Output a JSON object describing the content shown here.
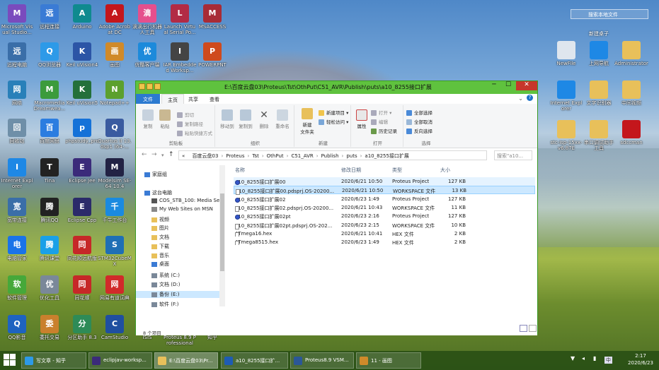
{
  "desktop_icons_left": [
    {
      "label": "Microsoft Visual Studio...",
      "icon": "visual-studio-icon",
      "color": "#7a4bbd"
    },
    {
      "label": "远程连接",
      "icon": "computer-icon",
      "color": "#3a7bd5"
    },
    {
      "label": "Arduino",
      "icon": "arduino-icon",
      "color": "#0f8a8f"
    },
    {
      "label": "Adobe Acrobat DC",
      "icon": "acrobat-icon",
      "color": "#c4161c"
    },
    {
      "label": "滴滴出行机器人工具",
      "icon": "app-icon",
      "color": "#e54f8d"
    },
    {
      "label": "Launch Virtual Serial Po...",
      "icon": "serial-icon",
      "color": "#b22b45"
    },
    {
      "label": "MSACCESS",
      "icon": "access-icon",
      "color": "#a82b36"
    },
    {
      "label": "远程电脑",
      "icon": "computer-icon",
      "color": "#3a6ea8"
    },
    {
      "label": "QQ浏览器",
      "icon": "qq-browser-icon",
      "color": "#2d9ae8"
    },
    {
      "label": "Keil uVision4",
      "icon": "keil-icon",
      "color": "#2c55a6"
    },
    {
      "label": "画图",
      "icon": "paint-icon",
      "color": "#d08a2a"
    },
    {
      "label": "优酷客户端",
      "icon": "youku-icon",
      "color": "#1c8adb"
    },
    {
      "label": "IAR Embedded Worksp...",
      "icon": "iar-icon",
      "color": "#444444"
    },
    {
      "label": "POWERPNT",
      "icon": "powerpoint-icon",
      "color": "#cf4a1d"
    },
    {
      "label": "网络",
      "icon": "network-icon",
      "color": "#2980b9"
    },
    {
      "label": "Macromedia Dreamwea...",
      "icon": "dreamweaver-icon",
      "color": "#3c9b3c"
    },
    {
      "label": "Keil uVision5",
      "icon": "keil-icon",
      "color": "#24703a"
    },
    {
      "label": "Notepad++",
      "icon": "notepad-icon",
      "color": "#5ca02e"
    },
    {
      "label": "回收站",
      "icon": "recycle-bin-icon",
      "color": "#6f8fa8"
    },
    {
      "label": "百度网盘",
      "icon": "baidu-pan-icon",
      "color": "#2b7de0"
    },
    {
      "label": "phpstudy_pro",
      "icon": "phpstudy-icon",
      "color": "#1572d8"
    },
    {
      "label": "Quartus II 13.0sp1 (64-...",
      "icon": "quartus-icon",
      "color": "#3a5ba0"
    },
    {
      "label": "Internet Explorer",
      "icon": "ie-icon",
      "color": "#1e88e5"
    },
    {
      "label": "Tina",
      "icon": "tina-icon",
      "color": "#222222"
    },
    {
      "label": "Eclipse Jee",
      "icon": "eclipse-icon",
      "color": "#3b2b7a"
    },
    {
      "label": "Modelsim SE-64 10.4",
      "icon": "modelsim-icon",
      "color": "#222244"
    },
    {
      "label": "宽带连接",
      "icon": "broadband-icon",
      "color": "#3a6ea8"
    },
    {
      "label": "腾讯QQ",
      "icon": "qq-icon",
      "color": "#222222"
    },
    {
      "label": "Eclipse Cpp",
      "icon": "eclipse-icon",
      "color": "#2b2b6a"
    },
    {
      "label": "千牛工作台",
      "icon": "qianniu-icon",
      "color": "#1a8ae0"
    },
    {
      "label": "电脑管家",
      "icon": "pc-manager-icon",
      "color": "#1a73e8"
    },
    {
      "label": "腾讯课堂",
      "icon": "tencent-class-icon",
      "color": "#1aa0e8"
    },
    {
      "label": "同花顺远航版",
      "icon": "tonghuashun-icon",
      "color": "#c62828"
    },
    {
      "label": "STM32CubeMX",
      "icon": "stm32cubemx-icon",
      "color": "#1f6fb5"
    },
    {
      "label": "软件管理",
      "icon": "software-icon",
      "color": "#46a83a"
    },
    {
      "label": "优化工具",
      "icon": "tool-icon",
      "color": "#7a8899"
    },
    {
      "label": "同花顺",
      "icon": "tonghuashun-icon",
      "color": "#c62828"
    },
    {
      "label": "网易有道词典",
      "icon": "youdao-icon",
      "color": "#d12a2a"
    },
    {
      "label": "QQ影音",
      "icon": "qq-player-icon",
      "color": "#1e63c0"
    },
    {
      "label": "委托交易",
      "icon": "trade-icon",
      "color": "#c9802d"
    },
    {
      "label": "分区助手 8.3",
      "icon": "partition-icon",
      "color": "#2e8b57"
    },
    {
      "label": "CamStudio",
      "icon": "camstudio-icon",
      "color": "#1f4fa0"
    },
    {
      "label": "ISIS",
      "icon": "isis-icon",
      "color": "#2d4e8a"
    },
    {
      "label": "Proteus 8.9 Professional",
      "icon": "proteus-icon",
      "color": "#1e5cb3"
    },
    {
      "label": "知乎",
      "icon": "zhihu-icon",
      "color": "#1772f6"
    }
  ],
  "desktop_icons_right": [
    {
      "label": "NewFile",
      "icon": "file-icon",
      "color": "#dfe6ee"
    },
    {
      "label": "上网导航",
      "icon": "ie-icon",
      "color": "#1e88e5"
    },
    {
      "label": "Administrator",
      "icon": "folder-icon",
      "color": "#e8c05a"
    },
    {
      "label": "Internet Explorer",
      "icon": "ie-icon",
      "color": "#1e88e5"
    },
    {
      "label": "文字识别器",
      "icon": "folder-icon",
      "color": "#e8c05a"
    },
    {
      "label": "中间视频",
      "icon": "folder-icon",
      "color": "#e8c05a"
    },
    {
      "label": "stc-isp-15xx-v6.87E",
      "icon": "folder-icon",
      "color": "#e8c05a"
    },
    {
      "label": "串口调试助手工具",
      "icon": "folder-icon",
      "color": "#e8c05a"
    },
    {
      "label": "sdccman",
      "icon": "pdf-icon",
      "color": "#c4161c"
    }
  ],
  "desktop_search": "搜索本地文件",
  "desktop_new_folder": "新建桌子",
  "window": {
    "title": "E:\\百度云盘03\\Proteus\\Tst\\OthPut\\C51_AVR\\Publish\\puts\\a10_8255接口扩展",
    "minimize": "─",
    "maximize": "☐",
    "close": "✕",
    "tabs": [
      "文件",
      "主页",
      "共享",
      "查看"
    ],
    "ribbon": {
      "clipboard": {
        "name": "剪贴板",
        "copy": "复制",
        "paste": "粘贴",
        "cut": "剪切",
        "copy_path": "复制路径",
        "paste_shortcut": "粘贴快捷方式"
      },
      "organize": {
        "name": "组织",
        "move_to": "移动到",
        "copy_to": "复制到",
        "delete": "删除",
        "rename": "重命名"
      },
      "new": {
        "name": "新建",
        "new_folder": "新建\n文件夹",
        "new_item": "新建项目 ▾",
        "easy_access": "轻松访问 ▾"
      },
      "open": {
        "name": "打开",
        "properties": "属性",
        "open": "打开 ▾",
        "edit": "编辑",
        "history": "历史记录"
      },
      "select": {
        "name": "选择",
        "select_all": "全部选择",
        "select_none": "全部取消",
        "invert": "反向选择"
      }
    },
    "address": {
      "back": "←",
      "forward": "→",
      "up": "↑",
      "crumbs": [
        "«",
        "百度云盘03",
        "Proteus",
        "Tst",
        "OthPut",
        "C51_AVR",
        "Publish",
        "puts",
        "a10_8255接口扩展"
      ],
      "search_placeholder": "搜索\"a10..."
    },
    "nav_pane": [
      {
        "label": "家庭组",
        "icon": "homegroup-icon",
        "color": "#3a7bd5"
      },
      {
        "label": "这台电脑",
        "icon": "computer-icon",
        "color": "#3a7bd5"
      },
      {
        "label": "COS_STB_100: Media Serv",
        "icon": "media-server-icon",
        "color": "#555555"
      },
      {
        "label": "My Web Sites on MSN",
        "icon": "web-folder-icon",
        "color": "#888888"
      },
      {
        "label": "视频",
        "icon": "video-folder-icon",
        "color": "#e8c05a"
      },
      {
        "label": "图片",
        "icon": "picture-folder-icon",
        "color": "#e8c05a"
      },
      {
        "label": "文档",
        "icon": "document-folder-icon",
        "color": "#e8c05a"
      },
      {
        "label": "下载",
        "icon": "download-folder-icon",
        "color": "#e8c05a"
      },
      {
        "label": "音乐",
        "icon": "music-folder-icon",
        "color": "#e8c05a"
      },
      {
        "label": "桌面",
        "icon": "desktop-folder-icon",
        "color": "#3a7bd5"
      },
      {
        "label": "系统 (C:)",
        "icon": "drive-icon",
        "color": "#7a8899"
      },
      {
        "label": "文档 (D:)",
        "icon": "drive-icon",
        "color": "#7a8899"
      },
      {
        "label": "备份 (E:)",
        "icon": "drive-icon",
        "color": "#7a8899"
      },
      {
        "label": "软件 (F:)",
        "icon": "drive-icon",
        "color": "#7a8899"
      }
    ],
    "columns": [
      "名称",
      "修改日期",
      "类型",
      "大小"
    ],
    "files": [
      {
        "name": "a10_8255接口扩展00",
        "date": "2020/6/21 10:50",
        "type": "Proteus Project",
        "size": "127 KB",
        "icon": "proteus-project-icon"
      },
      {
        "name": "a10_8255接口扩展00.pdsprj.OS-20200...",
        "date": "2020/6/21 10:50",
        "type": "WORKSPACE 文件",
        "size": "13 KB",
        "icon": "file-icon"
      },
      {
        "name": "a10_8255接口扩展02",
        "date": "2020/6/23 1:49",
        "type": "Proteus Project",
        "size": "127 KB",
        "icon": "proteus-project-icon"
      },
      {
        "name": "a10_8255接口扩展02.pdsprj.OS-20200...",
        "date": "2020/6/21 10:43",
        "type": "WORKSPACE 文件",
        "size": "11 KB",
        "icon": "file-icon"
      },
      {
        "name": "a10_8255接口扩展02pt",
        "date": "2020/6/23 2:16",
        "type": "Proteus Project",
        "size": "127 KB",
        "icon": "proteus-project-icon"
      },
      {
        "name": "a10_8255接口扩展02pt.pdsprj.OS-202...",
        "date": "2020/6/23 2:15",
        "type": "WORKSPACE 文件",
        "size": "10 KB",
        "icon": "file-icon"
      },
      {
        "name": "ATmega16.hex",
        "date": "2020/6/21 10:41",
        "type": "HEX 文件",
        "size": "2 KB",
        "icon": "hex-file-icon"
      },
      {
        "name": "ATmega8515.hex",
        "date": "2020/6/23 1:49",
        "type": "HEX 文件",
        "size": "2 KB",
        "icon": "hex-file-icon"
      }
    ],
    "selected_row": 1,
    "status": "8 个项目"
  },
  "taskbar": {
    "buttons": [
      {
        "label": "写文章 - 知乎",
        "icon": "browser-icon",
        "color": "#2d9ae8"
      },
      {
        "label": "eclipjav-worksp...",
        "icon": "eclipse-icon",
        "color": "#3b2b7a"
      },
      {
        "label": "E:\\百度云盘03\\Pr...",
        "icon": "folder-icon",
        "color": "#e8c05a"
      },
      {
        "label": "a10_8255接口扩...",
        "icon": "proteus-icon",
        "color": "#1e5cb3"
      },
      {
        "label": "Proteus8.9 VSM...",
        "icon": "word-icon",
        "color": "#2b5797"
      },
      {
        "label": "11 - 画图",
        "icon": "paint-icon",
        "color": "#d08a2a"
      }
    ],
    "tray_icons": [
      "shield-icon",
      "speaker-icon",
      "network-icon",
      "keyboard-icon"
    ],
    "time": "2:17",
    "date": "2020/6/23"
  }
}
